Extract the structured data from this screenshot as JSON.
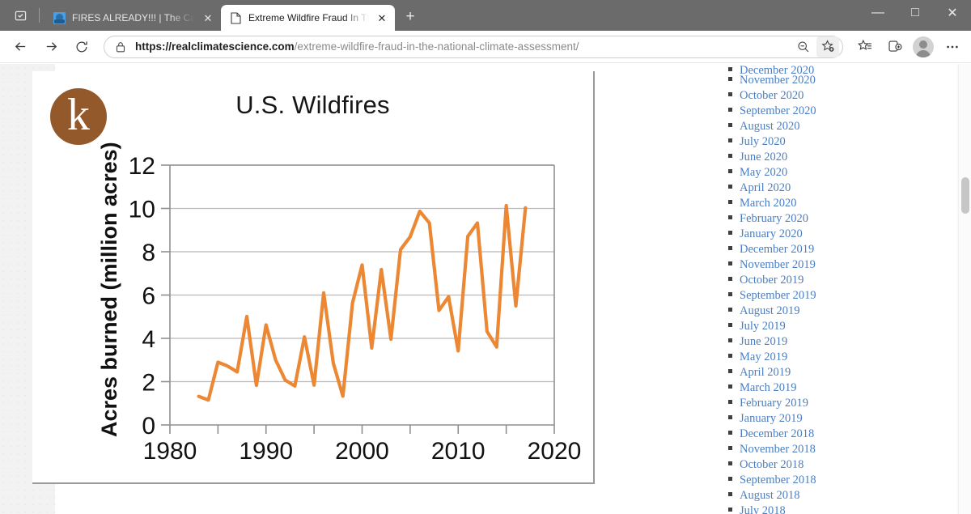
{
  "window": {
    "controls": {
      "minimize": "—",
      "maximize": "□",
      "close": "✕"
    }
  },
  "tabs": {
    "tab_search_icon": "tab-search-icon",
    "new_tab_label": "+",
    "items": [
      {
        "title": "FIRES ALREADY!!! | The Campfire",
        "favicon": "site-favicon",
        "active": false,
        "close_label": "✕"
      },
      {
        "title": "Extreme Wildfire Fraud In The Na",
        "favicon": "page-icon",
        "active": true,
        "close_label": "✕"
      }
    ]
  },
  "navbar": {
    "back_label": "←",
    "forward_label": "→",
    "reload_label": "⟳",
    "lock_icon": "lock-icon",
    "url_scheme": "https://",
    "url_host": "realclimatescience.com",
    "url_path": "/extreme-wildfire-fraud-in-the-national-climate-assessment/",
    "url_full": "https://realclimatescience.com/extreme-wildfire-fraud-in-the-national-climate-assessment/",
    "actions": [
      {
        "name": "zoom-out-icon",
        "label": "zoom-out"
      },
      {
        "name": "add-favorite-icon",
        "label": "add-favorite"
      }
    ],
    "right_icons": [
      {
        "name": "favorites-icon",
        "label": "favorites"
      },
      {
        "name": "collections-icon",
        "label": "collections"
      },
      {
        "name": "profile-avatar",
        "label": "profile"
      },
      {
        "name": "settings-more-icon",
        "label": "⋯"
      }
    ]
  },
  "figure": {
    "logo_letter": "k",
    "logo_color": "#94592a"
  },
  "chart_data": {
    "type": "line",
    "title": "U.S. Wildfires",
    "xlabel": "",
    "ylabel": "Acres burned (million acres)",
    "line_color": "#ec8733",
    "grid": true,
    "legend": "none",
    "xlim": [
      1980,
      2020
    ],
    "ylim": [
      0,
      12
    ],
    "xticks": [
      1980,
      1990,
      2000,
      2010,
      2020
    ],
    "yticks": [
      0,
      2,
      4,
      6,
      8,
      10,
      12
    ],
    "x": [
      1983,
      1984,
      1985,
      1986,
      1987,
      1988,
      1989,
      1990,
      1991,
      1992,
      1993,
      1994,
      1995,
      1996,
      1997,
      1998,
      1999,
      2000,
      2001,
      2002,
      2003,
      2004,
      2005,
      2006,
      2007,
      2008,
      2009,
      2010,
      2011,
      2012,
      2013,
      2014,
      2015,
      2016,
      2017
    ],
    "values": [
      1.32,
      1.15,
      2.9,
      2.72,
      2.45,
      5.01,
      1.83,
      4.62,
      3.0,
      2.07,
      1.8,
      4.07,
      1.84,
      6.1,
      2.86,
      1.33,
      5.63,
      7.39,
      3.55,
      7.18,
      3.96,
      8.1,
      8.69,
      9.87,
      9.33,
      5.29,
      5.92,
      3.42,
      8.71,
      9.33,
      4.32,
      3.6,
      10.13,
      5.5,
      10.03
    ],
    "unit": "million acres"
  },
  "sidebar": {
    "archive_items": [
      {
        "label": "December 2020",
        "clipped": true
      },
      {
        "label": "November 2020"
      },
      {
        "label": "October 2020"
      },
      {
        "label": "September 2020"
      },
      {
        "label": "August 2020"
      },
      {
        "label": "July 2020"
      },
      {
        "label": "June 2020"
      },
      {
        "label": "May 2020"
      },
      {
        "label": "April 2020"
      },
      {
        "label": "March 2020"
      },
      {
        "label": "February 2020"
      },
      {
        "label": "January 2020"
      },
      {
        "label": "December 2019"
      },
      {
        "label": "November 2019"
      },
      {
        "label": "October 2019"
      },
      {
        "label": "September 2019"
      },
      {
        "label": "August 2019"
      },
      {
        "label": "July 2019"
      },
      {
        "label": "June 2019"
      },
      {
        "label": "May 2019"
      },
      {
        "label": "April 2019"
      },
      {
        "label": "March 2019"
      },
      {
        "label": "February 2019"
      },
      {
        "label": "January 2019"
      },
      {
        "label": "December 2018"
      },
      {
        "label": "November 2018"
      },
      {
        "label": "October 2018"
      },
      {
        "label": "September 2018"
      },
      {
        "label": "August 2018"
      },
      {
        "label": "July 2018"
      }
    ],
    "link_color": "#4a7ec4"
  }
}
